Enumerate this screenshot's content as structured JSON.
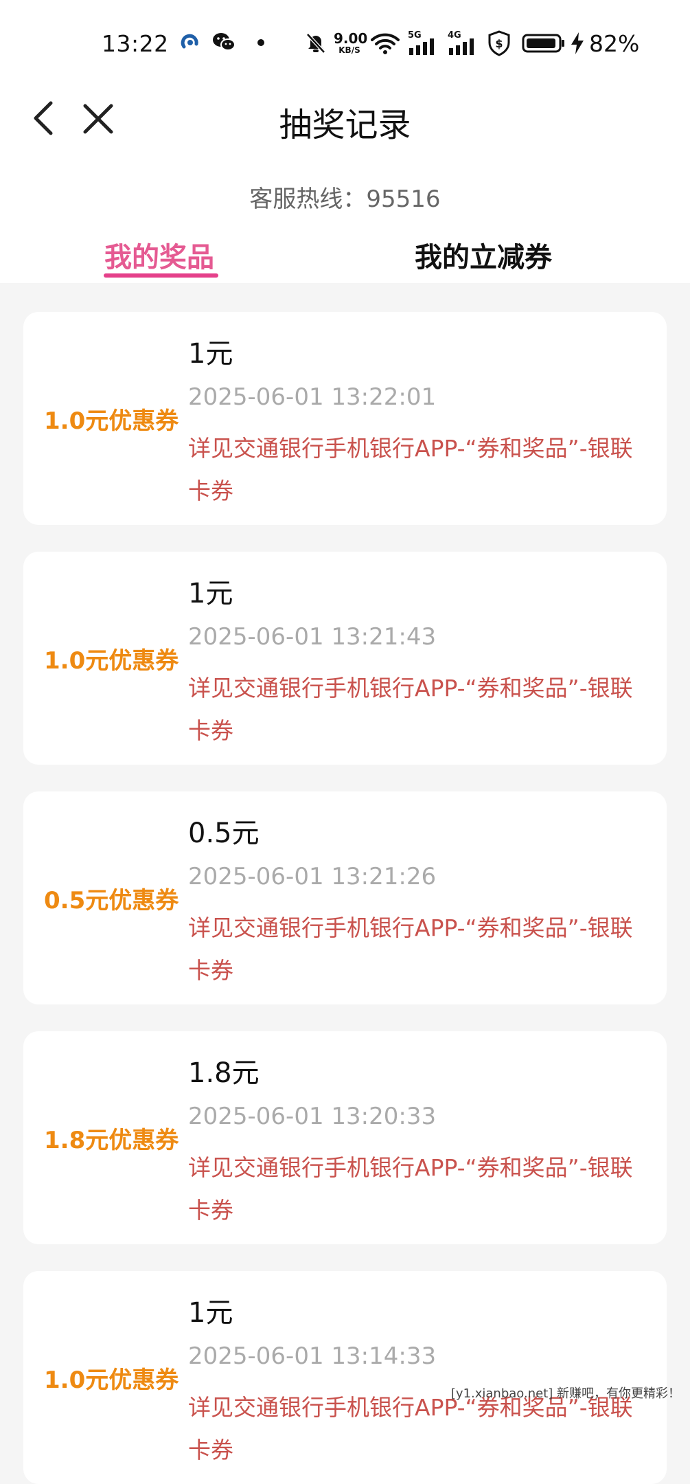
{
  "status_bar": {
    "time": "13:22",
    "net_speed_value": "9.00",
    "net_speed_unit": "KB/S",
    "signal_1": "5G",
    "signal_2": "4G",
    "battery": "82%"
  },
  "nav": {
    "title": "抽奖记录",
    "back_icon": "chevron-left-icon",
    "close_icon": "close-icon"
  },
  "hotline": "客服热线：95516",
  "tabs": [
    {
      "label": "我的奖品",
      "active": true
    },
    {
      "label": "我的立减券",
      "active": false
    }
  ],
  "records": [
    {
      "coupon": "1.0元优惠券",
      "amount": "1元",
      "datetime": "2025-06-01 13:22:01",
      "detail": "详见交通银行手机银行APP-“券和奖品”-银联卡券"
    },
    {
      "coupon": "1.0元优惠券",
      "amount": "1元",
      "datetime": "2025-06-01 13:21:43",
      "detail": "详见交通银行手机银行APP-“券和奖品”-银联卡券"
    },
    {
      "coupon": "0.5元优惠券",
      "amount": "0.5元",
      "datetime": "2025-06-01 13:21:26",
      "detail": "详见交通银行手机银行APP-“券和奖品”-银联卡券"
    },
    {
      "coupon": "1.8元优惠券",
      "amount": "1.8元",
      "datetime": "2025-06-01 13:20:33",
      "detail": "详见交通银行手机银行APP-“券和奖品”-银联卡券"
    },
    {
      "coupon": "1.0元优惠券",
      "amount": "1元",
      "datetime": "2025-06-01 13:14:33",
      "detail": "详见交通银行手机银行APP-“券和奖品”-银联卡券"
    }
  ],
  "watermark": "[y1.xianbao.net] 新赚吧，有你更精彩！",
  "colors": {
    "accent": "#e5408a",
    "coupon": "#ee8a12",
    "detail": "#c9524d"
  }
}
